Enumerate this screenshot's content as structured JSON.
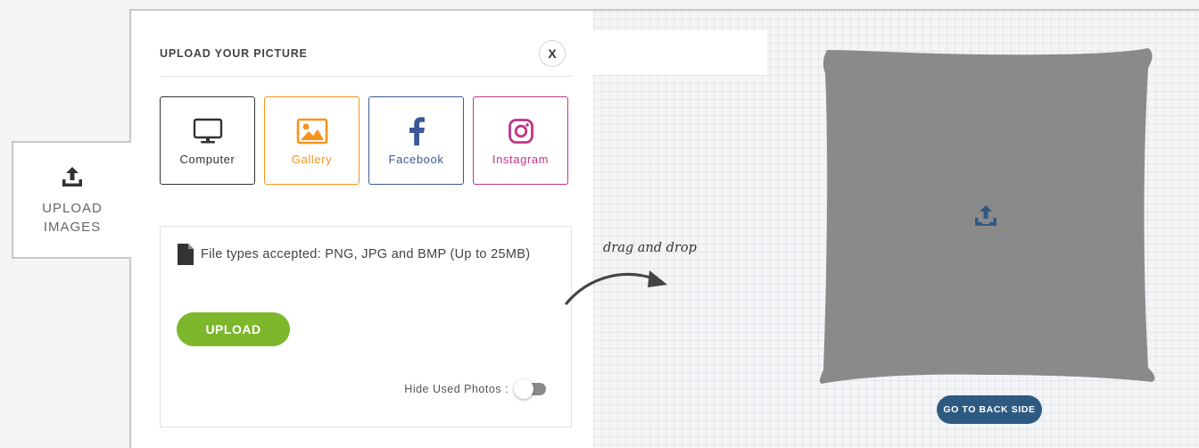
{
  "sidebar": {
    "upload_tab": {
      "line1": "UPLOAD",
      "line2": "IMAGES",
      "icon": "upload-icon"
    }
  },
  "panel": {
    "title": "UPLOAD YOUR PICTURE",
    "close_label": "X",
    "sources": [
      {
        "label": "Computer",
        "icon": "monitor-icon",
        "color": "#333333"
      },
      {
        "label": "Gallery",
        "icon": "image-icon",
        "color": "#f7941d"
      },
      {
        "label": "Facebook",
        "icon": "facebook-icon",
        "color": "#3b5998"
      },
      {
        "label": "Instagram",
        "icon": "instagram-icon",
        "color": "#c13584"
      }
    ],
    "file_types": "File types accepted: PNG, JPG and BMP (Up to 25MB)",
    "upload_button": "UPLOAD",
    "hide_used_label": "Hide Used Photos :",
    "hide_used_on": false
  },
  "canvas": {
    "drag_hint": "drag and drop",
    "back_button": "GO TO BACK SIDE",
    "product_color": "#8a8a8a",
    "accent": "#2e5a82"
  }
}
